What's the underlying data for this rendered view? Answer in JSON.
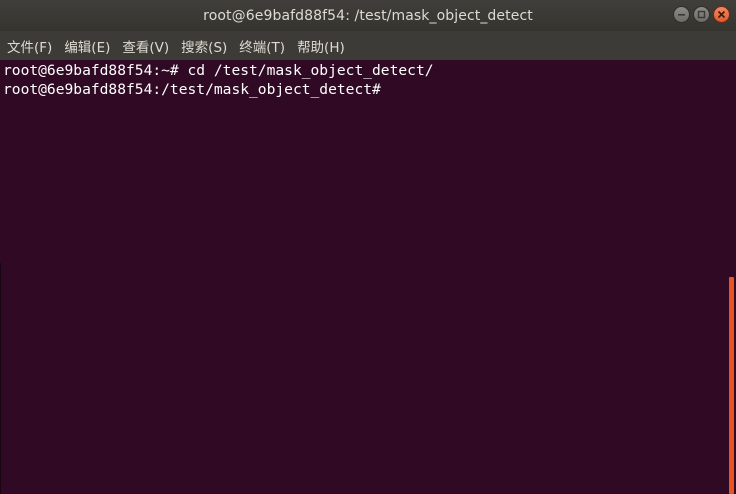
{
  "window": {
    "title": "root@6e9bafd88f54: /test/mask_object_detect",
    "controls": {
      "minimize_icon": "minimize-icon",
      "maximize_icon": "maximize-icon",
      "close_icon": "close-icon"
    }
  },
  "menu": {
    "items": [
      {
        "label": "文件(F)"
      },
      {
        "label": "编辑(E)"
      },
      {
        "label": "查看(V)"
      },
      {
        "label": "搜索(S)"
      },
      {
        "label": "终端(T)"
      },
      {
        "label": "帮助(H)"
      }
    ]
  },
  "terminal": {
    "lines": [
      "root@6e9bafd88f54:~# cd /test/mask_object_detect/",
      "root@6e9bafd88f54:/test/mask_object_detect#"
    ],
    "colors": {
      "background": "#300a24",
      "foreground": "#ffffff",
      "scrollbar": "#e95420"
    }
  }
}
